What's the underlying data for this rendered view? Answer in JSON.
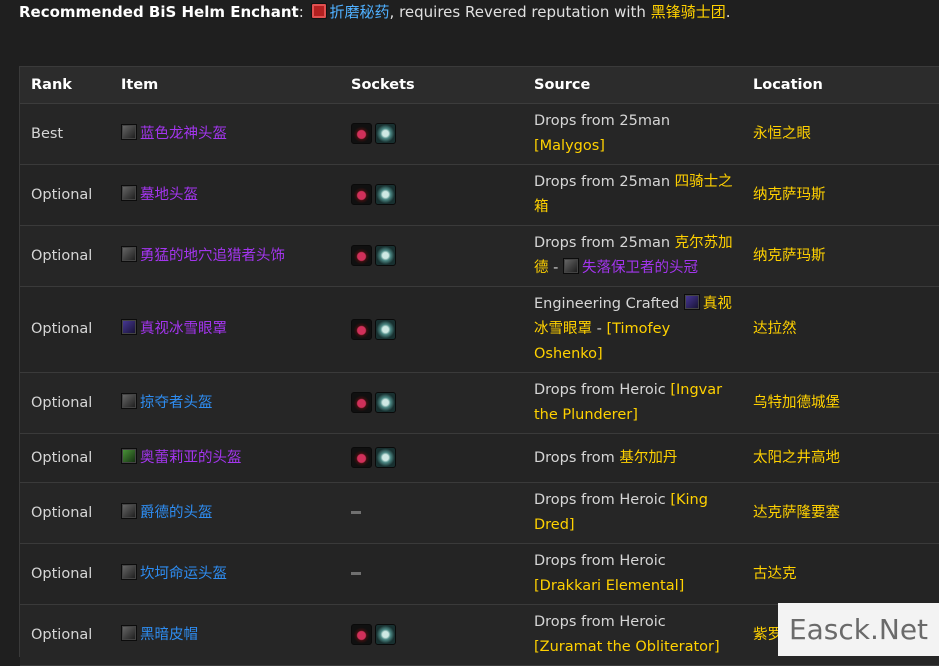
{
  "header": {
    "label": "Recommended BiS Helm Enchant",
    "colon": ": ",
    "spell": "折磨秘药",
    "mid_text": ", requires Revered reputation with ",
    "faction": "黑锋骑士团",
    "end": "."
  },
  "table": {
    "columns": [
      "Rank",
      "Item",
      "Sockets",
      "Source",
      "Location"
    ],
    "rows": [
      {
        "rank": "Best",
        "item": "蓝色龙神头盔",
        "item_color": "purple",
        "icon": "dark",
        "sockets": [
          "meta-socket",
          "prismatic-socket"
        ],
        "source_text": "Drops from 25man ",
        "source_link": "[Malygos]",
        "location": "永恒之眼"
      },
      {
        "rank": "Optional",
        "item": "墓地头盔",
        "item_color": "purple",
        "icon": "dark",
        "sockets": [
          "meta-socket",
          "prismatic-socket"
        ],
        "source_text": "Drops from 25man ",
        "source_link": "四骑士之箱",
        "location": "纳克萨玛斯"
      },
      {
        "rank": "Optional",
        "item": "勇猛的地穴追猎者头饰",
        "item_color": "purple",
        "icon": "dark",
        "sockets": [
          "meta-socket",
          "prismatic-socket"
        ],
        "source_text": "Drops from 25man ",
        "source_link": "克尔苏加德",
        "source_sep": " - ",
        "source_item": "失落保卫者的头冠",
        "location": "纳克萨玛斯"
      },
      {
        "rank": "Optional",
        "item": "真视冰雪眼罩",
        "item_color": "purple",
        "icon": "purple",
        "sockets": [
          "meta-socket",
          "prismatic-socket"
        ],
        "source_text": "Engineering Crafted ",
        "source_link": "真视冰雪眼罩",
        "source_sep": " - ",
        "source_link2": "[Timofey Oshenko]",
        "location": "达拉然"
      },
      {
        "rank": "Optional",
        "item": "掠夺者头盔",
        "item_color": "blue",
        "icon": "dark",
        "sockets": [
          "meta-socket",
          "prismatic-socket"
        ],
        "source_text": "Drops from Heroic ",
        "source_link": "[Ingvar the Plunderer]",
        "location": "乌特加德城堡"
      },
      {
        "rank": "Optional",
        "item": "奥蕾莉亚的头盔",
        "item_color": "purple",
        "icon": "green",
        "sockets": [
          "meta-socket",
          "prismatic-socket"
        ],
        "source_text": "Drops from ",
        "source_link": "基尔加丹",
        "location": "太阳之井高地"
      },
      {
        "rank": "Optional",
        "item": "爵德的头盔",
        "item_color": "blue",
        "icon": "dark",
        "sockets": [],
        "source_text": "Drops from Heroic ",
        "source_link": "[King Dred]",
        "location": "达克萨隆要塞"
      },
      {
        "rank": "Optional",
        "item": "坎坷命运头盔",
        "item_color": "blue",
        "icon": "dark",
        "sockets": [],
        "source_text": "Drops from Heroic ",
        "source_link": "[Drakkari Elemental]",
        "location": "古达克"
      },
      {
        "rank": "Optional",
        "item": "黑暗皮帽",
        "item_color": "blue",
        "icon": "dark",
        "sockets": [
          "meta-socket",
          "prismatic-socket"
        ],
        "source_text": "Drops from Heroic ",
        "source_link": "[Zuramat the Obliterator]",
        "location": "紫罗兰"
      }
    ]
  },
  "watermark": "Easck.Net"
}
